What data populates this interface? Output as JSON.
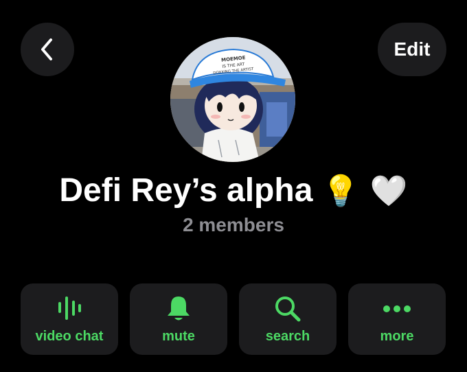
{
  "header": {
    "back_icon": "chevron-left-icon",
    "edit_label": "Edit"
  },
  "profile": {
    "avatar_icon": "group-avatar",
    "avatar_cap_text": [
      "MOEMOE",
      "IS THE ART",
      "DOXXING THE ARTIST"
    ],
    "name": "Defi Rey’s alpha",
    "name_emojis": "💡 🤍",
    "members": "2 members"
  },
  "actions": [
    {
      "label": "video chat",
      "icon": "voice-wave-icon"
    },
    {
      "label": "mute",
      "icon": "bell-icon"
    },
    {
      "label": "search",
      "icon": "search-icon"
    },
    {
      "label": "more",
      "icon": "ellipsis-icon"
    }
  ],
  "colors": {
    "background": "#000000",
    "button_bg": "#1c1c1e",
    "accent": "#4cd964",
    "muted_text": "#8e8e93",
    "text": "#ffffff"
  }
}
